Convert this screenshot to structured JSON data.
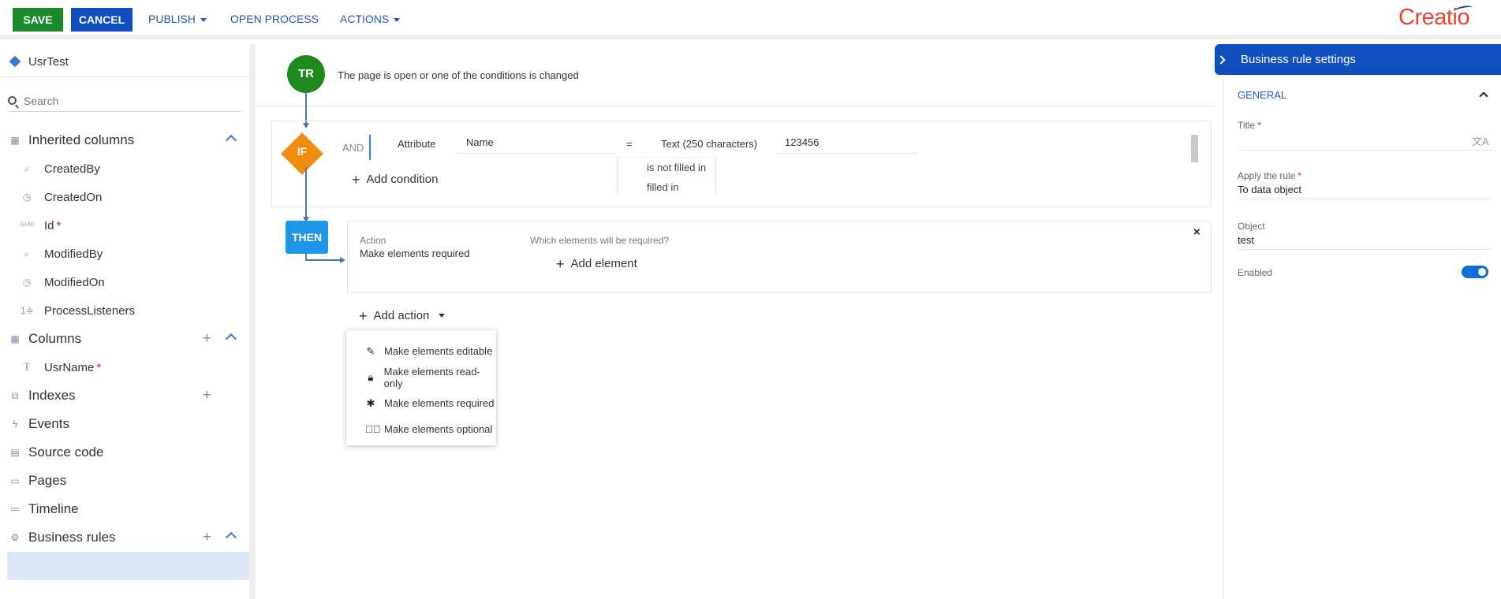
{
  "toolbar": {
    "save_label": "SAVE",
    "cancel_label": "CANCEL",
    "publish_label": "PUBLISH",
    "open_process_label": "OPEN PROCESS",
    "actions_label": "ACTIONS",
    "logo_text": "Creatio"
  },
  "sidebar": {
    "object_title": "UsrTest",
    "search_placeholder": "Search",
    "inherited_columns": {
      "label": "Inherited columns",
      "items": [
        "CreatedBy",
        "CreatedOn",
        "Id",
        "ModifiedBy",
        "ModifiedOn",
        "ProcessListeners"
      ]
    },
    "columns": {
      "label": "Columns",
      "items": [
        "UsrName"
      ]
    },
    "indexes_label": "Indexes",
    "events_label": "Events",
    "source_code_label": "Source code",
    "pages_label": "Pages",
    "timeline_label": "Timeline",
    "business_rules_label": "Business rules",
    "required_mark": "*",
    "guid_tag": "GUID"
  },
  "rule": {
    "trigger_badge": "TR",
    "trigger_text": "The page is open or one of the conditions is changed",
    "if_badge": "IF",
    "and_label": "AND",
    "condition": {
      "left_type": "Attribute",
      "left_value": "Name",
      "operator": "=",
      "right_type": "Text (250 characters)",
      "right_value": "123456"
    },
    "operator_dropdown_items": [
      "is not filled in",
      "filled in"
    ],
    "add_condition_label": "Add condition",
    "then_badge": "THEN",
    "action_caption": "Action",
    "action_value": "Make elements required",
    "elements_caption": "Which elements will be required?",
    "add_element_label": "Add element",
    "close_symbol": "×",
    "add_action_label": "Add action",
    "action_menu": [
      {
        "label": "Make elements editable",
        "icon": "edit-icon"
      },
      {
        "label": "Make elements read-only",
        "icon": "lock-icon"
      },
      {
        "label": "Make elements required",
        "icon": "asterisk-icon"
      },
      {
        "label": "Make elements optional",
        "icon": "check-circle-icon"
      }
    ]
  },
  "settings": {
    "header": "Business rule settings",
    "section": "GENERAL",
    "title_label": "Title",
    "title_value": "",
    "apply_label": "Apply the rule",
    "apply_value": "To data object",
    "object_label": "Object",
    "object_value": "test",
    "enabled_label": "Enabled",
    "enabled": true,
    "required_mark": "*"
  },
  "colors": {
    "save": "#1b8a2e",
    "cancel": "#0e4fbd",
    "trigger": "#1e8a1e",
    "if": "#f28c0f",
    "then": "#1f95e8",
    "logo": "#e8432f",
    "required": "#d9262c"
  }
}
